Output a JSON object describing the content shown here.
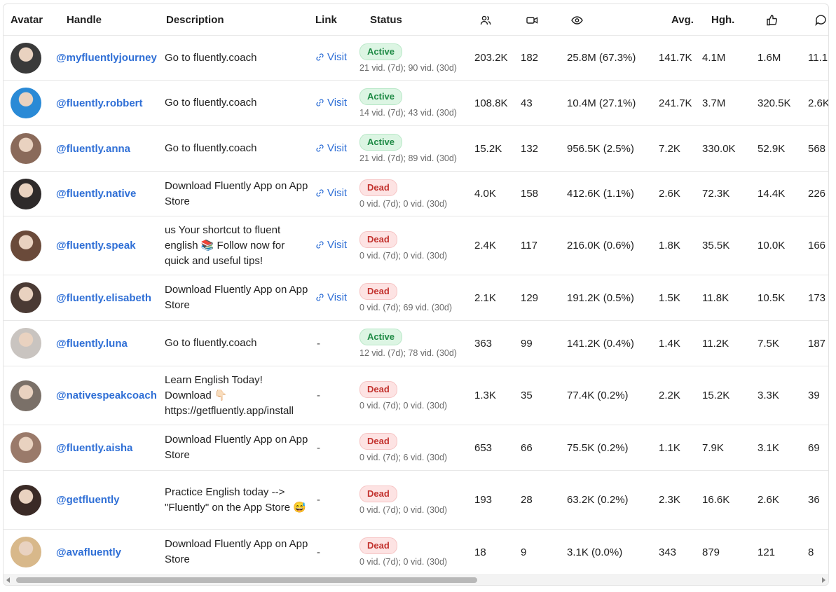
{
  "headers": {
    "avatar": "Avatar",
    "handle": "Handle",
    "description": "Description",
    "link": "Link",
    "status": "Status",
    "followers_icon": "users-icon",
    "videos_icon": "video-icon",
    "views_icon": "eye-icon",
    "avg": "Avg.",
    "hgh": "Hgh.",
    "likes_icon": "thumbs-up-icon",
    "comments_icon": "comment-icon"
  },
  "colors": {
    "link": "#2f6fd6",
    "active": "#1f8a45",
    "dead": "#c3332f"
  },
  "rows": [
    {
      "avatar_color": "#3a3a3a",
      "handle": "@myfluentlyjourney",
      "description": "Go to fluently.coach",
      "link": "Visit",
      "status": "Active",
      "status_sub": "21 vid. (7d); 90 vid. (30d)",
      "followers": "203.2K",
      "videos": "182",
      "views": "25.8M (67.3%)",
      "avg": "141.7K",
      "hgh": "4.1M",
      "likes": "1.6M",
      "comments": "11.1"
    },
    {
      "avatar_color": "#2a8ad6",
      "handle": "@fluently.robbert",
      "description": "Go to fluently.coach",
      "link": "Visit",
      "status": "Active",
      "status_sub": "14 vid. (7d); 43 vid. (30d)",
      "followers": "108.8K",
      "videos": "43",
      "views": "10.4M (27.1%)",
      "avg": "241.7K",
      "hgh": "3.7M",
      "likes": "320.5K",
      "comments": "2.6K"
    },
    {
      "avatar_color": "#8a6a5a",
      "handle": "@fluently.anna",
      "description": "Go to fluently.coach",
      "link": "Visit",
      "status": "Active",
      "status_sub": "21 vid. (7d); 89 vid. (30d)",
      "followers": "15.2K",
      "videos": "132",
      "views": "956.5K (2.5%)",
      "avg": "7.2K",
      "hgh": "330.0K",
      "likes": "52.9K",
      "comments": "568"
    },
    {
      "avatar_color": "#2e2a2a",
      "handle": "@fluently.native",
      "description": "Download Fluently App on App Store",
      "link": "Visit",
      "status": "Dead",
      "status_sub": "0 vid. (7d); 0 vid. (30d)",
      "followers": "4.0K",
      "videos": "158",
      "views": "412.6K (1.1%)",
      "avg": "2.6K",
      "hgh": "72.3K",
      "likes": "14.4K",
      "comments": "226"
    },
    {
      "avatar_color": "#6a4a3a",
      "handle": "@fluently.speak",
      "description": "us Your shortcut to fluent english 📚 Follow now for quick and useful tips!",
      "link": "Visit",
      "status": "Dead",
      "status_sub": "0 vid. (7d); 0 vid. (30d)",
      "followers": "2.4K",
      "videos": "117",
      "views": "216.0K (0.6%)",
      "avg": "1.8K",
      "hgh": "35.5K",
      "likes": "10.0K",
      "comments": "166"
    },
    {
      "avatar_color": "#4a3a34",
      "handle": "@fluently.elisabeth",
      "description": "Download Fluently App on App Store",
      "link": "Visit",
      "status": "Dead",
      "status_sub": "0 vid. (7d); 69 vid. (30d)",
      "followers": "2.1K",
      "videos": "129",
      "views": "191.2K (0.5%)",
      "avg": "1.5K",
      "hgh": "11.8K",
      "likes": "10.5K",
      "comments": "173"
    },
    {
      "avatar_color": "#c9c4c0",
      "handle": "@fluently.luna",
      "description": "Go to fluently.coach",
      "link": "-",
      "status": "Active",
      "status_sub": "12 vid. (7d); 78 vid. (30d)",
      "followers": "363",
      "videos": "99",
      "views": "141.2K (0.4%)",
      "avg": "1.4K",
      "hgh": "11.2K",
      "likes": "7.5K",
      "comments": "187"
    },
    {
      "avatar_color": "#7a7068",
      "handle": "@nativespeakcoach",
      "description": "Learn English Today! Download 👇🏻 https://getfluently.app/install",
      "link": "-",
      "status": "Dead",
      "status_sub": "0 vid. (7d); 0 vid. (30d)",
      "followers": "1.3K",
      "videos": "35",
      "views": "77.4K (0.2%)",
      "avg": "2.2K",
      "hgh": "15.2K",
      "likes": "3.3K",
      "comments": "39"
    },
    {
      "avatar_color": "#9a7a6a",
      "handle": "@fluently.aisha",
      "description": "Download Fluently App on App Store",
      "link": "-",
      "status": "Dead",
      "status_sub": "0 vid. (7d); 6 vid. (30d)",
      "followers": "653",
      "videos": "66",
      "views": "75.5K (0.2%)",
      "avg": "1.1K",
      "hgh": "7.9K",
      "likes": "3.1K",
      "comments": "69"
    },
    {
      "avatar_color": "#3a2a26",
      "handle": "@getfluently",
      "description": "Practice English today --> \"Fluently\" on the App Store 😅",
      "link": "-",
      "status": "Dead",
      "status_sub": "0 vid. (7d); 0 vid. (30d)",
      "followers": "193",
      "videos": "28",
      "views": "63.2K (0.2%)",
      "avg": "2.3K",
      "hgh": "16.6K",
      "likes": "2.6K",
      "comments": "36"
    },
    {
      "avatar_color": "#d8b88a",
      "handle": "@avafluently",
      "description": "Download Fluently App on App Store",
      "link": "-",
      "status": "Dead",
      "status_sub": "0 vid. (7d); 0 vid. (30d)",
      "followers": "18",
      "videos": "9",
      "views": "3.1K (0.0%)",
      "avg": "343",
      "hgh": "879",
      "likes": "121",
      "comments": "8"
    }
  ]
}
